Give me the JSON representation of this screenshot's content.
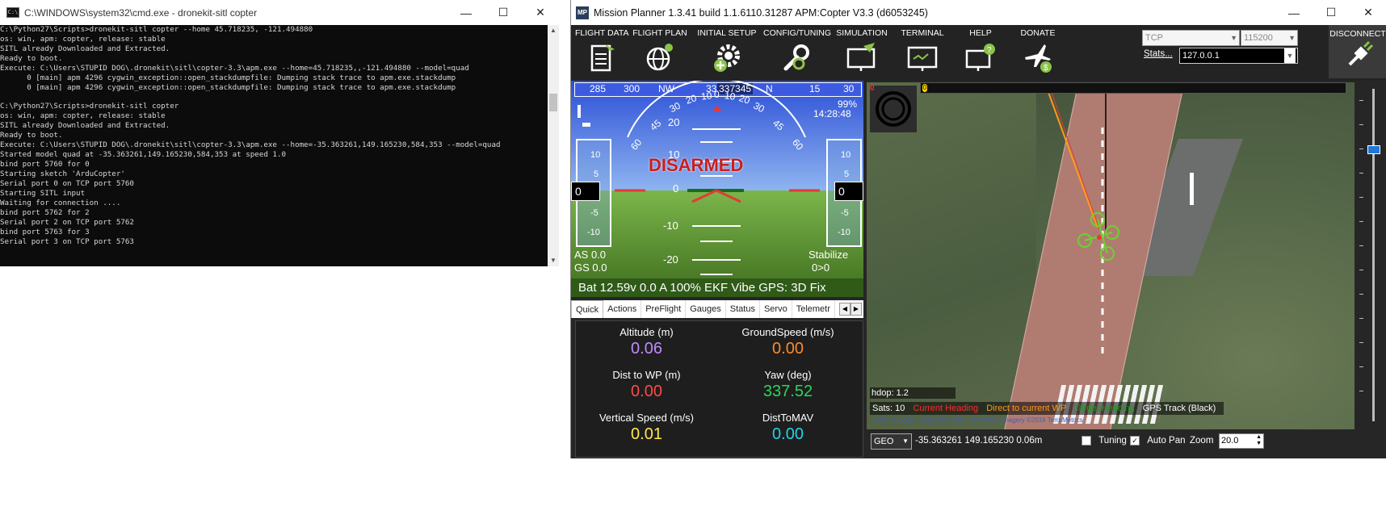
{
  "cmd": {
    "title": "C:\\WINDOWS\\system32\\cmd.exe - dronekit-sitl  copter",
    "lines": [
      "C:\\Python27\\Scripts>dronekit-sitl copter --home 45.718235, -121.494880",
      "os: win, apm: copter, release: stable",
      "SITL already Downloaded and Extracted.",
      "Ready to boot.",
      "Execute: C:\\Users\\STUPID DOG\\.dronekit\\sitl\\copter-3.3\\apm.exe --home=45.718235,,-121.494880 --model=quad",
      "      0 [main] apm 4296 cygwin_exception::open_stackdumpfile: Dumping stack trace to apm.exe.stackdump",
      "      0 [main] apm 4296 cygwin_exception::open_stackdumpfile: Dumping stack trace to apm.exe.stackdump",
      "",
      "C:\\Python27\\Scripts>dronekit-sitl copter",
      "os: win, apm: copter, release: stable",
      "SITL already Downloaded and Extracted.",
      "Ready to boot.",
      "Execute: C:\\Users\\STUPID DOG\\.dronekit\\sitl\\copter-3.3\\apm.exe --home=-35.363261,149.165230,584,353 --model=quad",
      "Started model quad at -35.363261,149.165230,584,353 at speed 1.0",
      "bind port 5760 for 0",
      "Starting sketch 'ArduCopter'",
      "Serial port 0 on TCP port 5760",
      "Starting SITL input",
      "Waiting for connection ....",
      "bind port 5762 for 2",
      "Serial port 2 on TCP port 5762",
      "bind port 5763 for 3",
      "Serial port 3 on TCP port 5763"
    ]
  },
  "mp": {
    "title": "Mission Planner 1.3.41 build 1.1.6110.31287 APM:Copter V3.3 (d6053245)",
    "logo_text": "MP",
    "menu": [
      {
        "label": "FLIGHT DATA",
        "icon": "clipboard-icon"
      },
      {
        "label": "FLIGHT PLAN",
        "icon": "globe-icon"
      },
      {
        "label": "INITIAL SETUP",
        "icon": "gear-plus-icon"
      },
      {
        "label": "CONFIG/TUNING",
        "icon": "wrench-icon"
      },
      {
        "label": "SIMULATION",
        "icon": "monitor-plane-icon"
      },
      {
        "label": "TERMINAL",
        "icon": "terminal-icon"
      },
      {
        "label": "HELP",
        "icon": "help-monitor-icon"
      },
      {
        "label": "DONATE",
        "icon": "plane-dollar-icon"
      }
    ],
    "connection": {
      "type": "TCP",
      "baud": "115200",
      "stats_label": "Stats...",
      "address": "127.0.0.1"
    },
    "disconnect_label": "DISCONNECT",
    "hud": {
      "compass": [
        "285",
        "300",
        "NW",
        "33",
        "337345",
        "N",
        "15",
        "30"
      ],
      "battery_pct": "99%",
      "time": "14:28:48",
      "status": "DISARMED",
      "airspeed": "AS 0.0",
      "groundspeed": "GS 0.0",
      "mode": "Stabilize",
      "wp": "0>0",
      "speed_tape": [
        "10",
        "5",
        "0",
        "-5",
        "-10"
      ],
      "alt_tape": [
        "10",
        "5",
        "0",
        "-5",
        "-10"
      ],
      "pitch": [
        "20",
        "10",
        "0",
        "-10",
        "-20"
      ],
      "roll": [
        "60",
        "45",
        "30",
        "20",
        "10",
        "0",
        "10",
        "20",
        "30",
        "45",
        "60"
      ],
      "speed_value": "0",
      "alt_value": "0",
      "bottom": "Bat 12.59v 0.0 A 100% EKF  Vibe  GPS: 3D Fix"
    },
    "tabs": [
      "Quick",
      "Actions",
      "PreFlight",
      "Gauges",
      "Status",
      "Servo",
      "Telemetr"
    ],
    "quick": [
      {
        "label": "Altitude (m)",
        "value": "0.06",
        "color": "#c08cff"
      },
      {
        "label": "GroundSpeed (m/s)",
        "value": "0.00",
        "color": "#ff8a2a"
      },
      {
        "label": "Dist to WP (m)",
        "value": "0.00",
        "color": "#ff4a4a"
      },
      {
        "label": "Yaw (deg)",
        "value": "337.52",
        "color": "#2fd35a"
      },
      {
        "label": "Vertical Speed (m/s)",
        "value": "0.01",
        "color": "#ffe84a"
      },
      {
        "label": "DistToMAV",
        "value": "0.00",
        "color": "#22d3e8"
      }
    ],
    "map": {
      "zero_marker": "0",
      "hdop": "hdop: 1.2",
      "sats": "Sats: 10",
      "legend": [
        {
          "label": "Current Heading",
          "color": "#ff2a2a"
        },
        {
          "label": "Direct to current WP",
          "color": "#ff9a1a"
        },
        {
          "label": "Target Heading",
          "color": "#1b9a1b"
        },
        {
          "label": "GPS Track (Black)",
          "color": "#ffffff"
        }
      ],
      "copyright": "©2016 Google - Map data ©2016 Tele Atlas, Imagery ©2016 TerraMetrics",
      "coord_mode": "GEO",
      "coords": "-35.363261 149.165230   0.06m",
      "tuning_label": "Tuning",
      "autopan_label": "Auto Pan",
      "zoom_label": "Zoom",
      "zoom_value": "20.0"
    }
  }
}
